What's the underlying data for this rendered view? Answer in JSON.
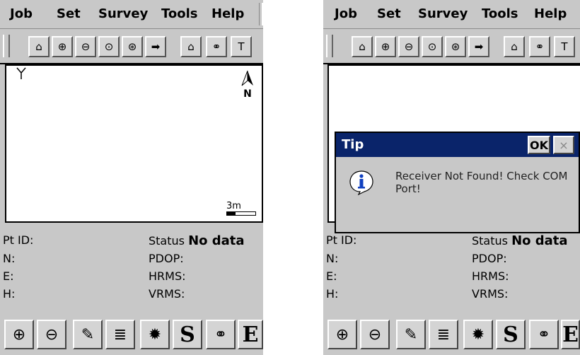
{
  "menu": [
    "Job",
    "Set",
    "Survey",
    "Tools",
    "Help"
  ],
  "toolbar_icons": [
    "home-up-icon",
    "zoom-in-icon",
    "zoom-out-icon",
    "zoom-window-icon",
    "zoom-extent-icon",
    "arrow-right-icon",
    "station-icon",
    "binoculars-icon",
    "tc-icon"
  ],
  "toolbar_glyphs": [
    "⌂",
    "⊕",
    "⊖",
    "⊙",
    "⊛",
    "➡",
    "⌂",
    "⚭",
    "T"
  ],
  "map": {
    "north_label": "N",
    "scale_label": "3m"
  },
  "info": {
    "pt_id_label": "Pt ID:",
    "n_label": "N:",
    "e_label": "E:",
    "h_label": "H:",
    "status_label": "Status",
    "status_value": "No data",
    "pdop_label": "PDOP:",
    "hrms_label": "HRMS:",
    "vrms_label": "VRMS:"
  },
  "bottom_buttons": [
    {
      "name": "zoom-in-button",
      "glyph": "⊕"
    },
    {
      "name": "zoom-out-button",
      "glyph": "⊖"
    },
    {
      "name": "wrench-button",
      "glyph": "✎"
    },
    {
      "name": "list-button",
      "glyph": "≣"
    },
    {
      "name": "gear-button",
      "glyph": "✹"
    },
    {
      "name": "s-button",
      "glyph": "S"
    },
    {
      "name": "binoculars-button",
      "glyph": "⚭"
    },
    {
      "name": "e-button",
      "glyph": "E"
    }
  ],
  "dialog": {
    "title": "Tip",
    "ok_label": "OK",
    "close_label": "×",
    "message": "Receiver Not Found! Check COM Port!"
  },
  "colors": {
    "titlebar": "#0a246a",
    "background": "#c8c8c8",
    "icon_blue": "#1040c0"
  }
}
